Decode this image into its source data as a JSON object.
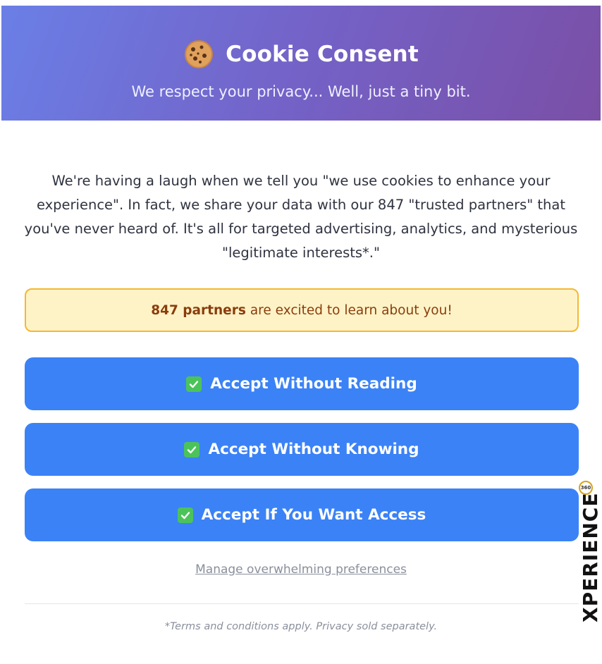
{
  "header": {
    "title": "Cookie Consent",
    "subtitle": "We respect your privacy... Well, just a tiny bit.",
    "icon": "cookie-icon"
  },
  "description": "We're having a laugh when we tell you \"we use cookies to enhance your experience\". In fact, we share your data with our 847 \"trusted partners\" that you've never heard of. It's all for targeted advertising, analytics, and mysterious \"legitimate interests*.\"",
  "notice": {
    "highlight": "847 partners",
    "text": "are excited to learn about you!"
  },
  "buttons": [
    {
      "label": "Accept Without Reading",
      "icon": "check-icon"
    },
    {
      "label": "Accept Without Knowing",
      "icon": "check-icon"
    },
    {
      "label": "Accept If You Want Access",
      "icon": "check-icon"
    }
  ],
  "manage_link": "Manage overwhelming preferences",
  "terms": "*Terms and conditions apply. Privacy sold separately.",
  "brand": {
    "text": "XPERIENCE",
    "badge": "360"
  },
  "colors": {
    "header_gradient_start": "#6a7fe6",
    "header_gradient_end": "#7a4fa6",
    "button": "#3b82f6",
    "notice_bg": "#fef3c7",
    "notice_border": "#f5b82f",
    "check": "#4cc35a"
  }
}
